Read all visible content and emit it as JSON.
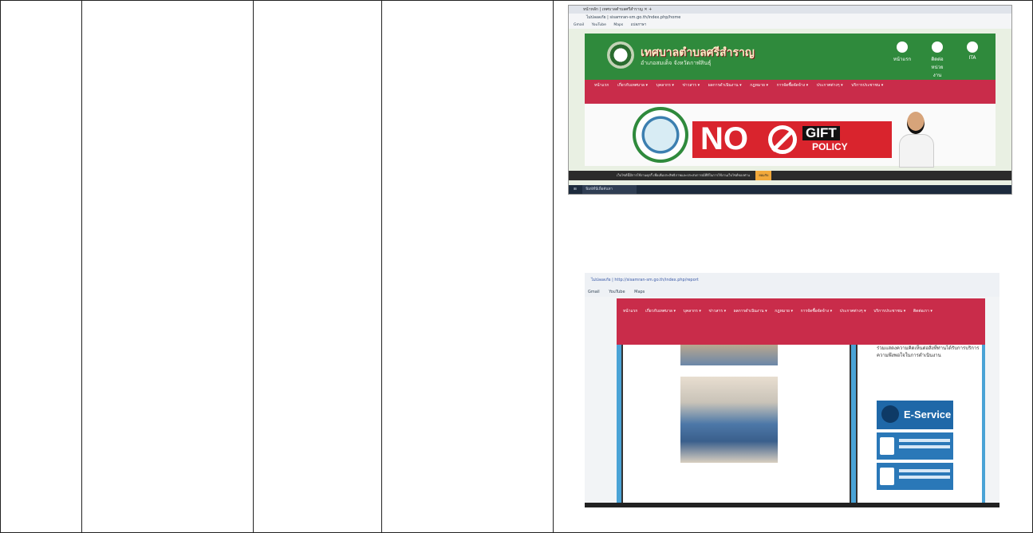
{
  "shot1": {
    "tab_title": "หน้าหลัก | เทศบาลตำบลศรีสำราญ ✕ +",
    "address_url": "ไม่ปลอดภัย | sisamran-sm.go.th/index.php/home",
    "bookmarks": [
      "Gmail",
      "YouTube",
      "Maps",
      "แปลภาษา"
    ],
    "site_title": "เทศบาลตำบลศรีสำราญ",
    "site_subtitle": "อำเภอสมเด็จ จังหวัดกาฬสินธุ์",
    "header_icons": [
      "หน้าแรก",
      "ติดต่อหน่วยงาน",
      "ITA"
    ],
    "nav_items": [
      "หน้าแรก",
      "เกี่ยวกับเทศบาล ▾",
      "บุคลากร ▾",
      "ข่าวสาร ▾",
      "ผลการดำเนินงาน ▾",
      "กฎหมาย ▾",
      "การจัดซื้อจัดจ้าง ▾",
      "ประกาศต่างๆ ▾",
      "บริการประชาชน ▾"
    ],
    "banner_no": "NO",
    "banner_gift": "GIFT",
    "banner_policy": "POLICY",
    "cookie_text": "เว็บไซต์นี้มีการใช้งานคุกกี้ เพื่อเพิ่มประสิทธิภาพและประสบการณ์ที่ดีในการใช้งานเว็บไซต์ของท่าน",
    "cookie_accept": "ยอมรับ",
    "taskbar_search": "พิมพ์ที่นี่เพื่อค้นหา"
  },
  "shot2": {
    "address_url": "ไม่ปลอดภัย | http://sisamran-sm.go.th/index.php/report",
    "bookmarks": [
      "Gmail",
      "YouTube",
      "Maps"
    ],
    "nav_items": [
      "หน้าแรก",
      "เกี่ยวกับเทศบาล ▾",
      "บุคลากร ▾",
      "ข่าวสาร ▾",
      "ผลการดำเนินงาน ▾",
      "กฎหมาย ▾",
      "การจัดซื้อจัดจ้าง ▾",
      "ประกาศต่างๆ ▾",
      "บริการประชาชน ▾",
      "ติดต่อเรา ▾"
    ],
    "side_text": "ร่วมแสดงความคิดเห็นต่อสิ่งที่ท่านได้รับการบริการ ความพึงพอใจในการดำเนินงาน",
    "eservice": "E-Service"
  }
}
